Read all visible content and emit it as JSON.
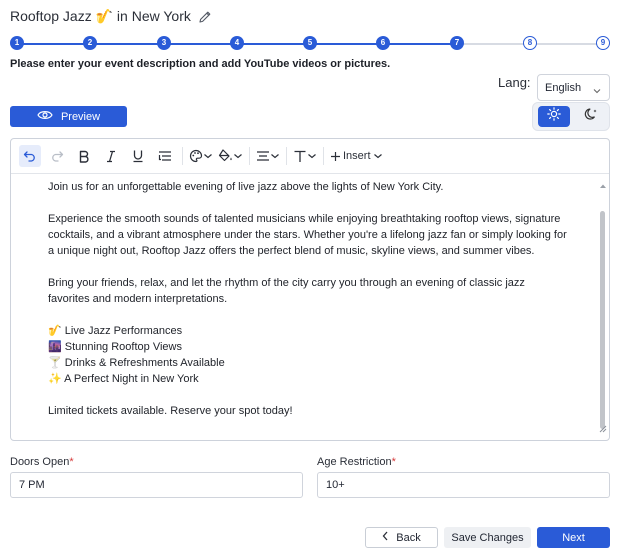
{
  "event": {
    "title": "Rooftop Jazz 🎷 in New York"
  },
  "stepper": {
    "steps": [
      {
        "label": "1",
        "done": true
      },
      {
        "label": "2",
        "done": true
      },
      {
        "label": "3",
        "done": true
      },
      {
        "label": "4",
        "done": true
      },
      {
        "label": "5",
        "done": true
      },
      {
        "label": "6",
        "done": true
      },
      {
        "label": "7",
        "done": true
      },
      {
        "label": "8",
        "done": false
      },
      {
        "label": "9",
        "done": false
      }
    ]
  },
  "instruction": "Please enter your event description and add YouTube videos or pictures.",
  "language": {
    "label": "Lang:",
    "selected": "English"
  },
  "preview_label": "Preview",
  "toolbar": {
    "insert_label": "Insert"
  },
  "description": {
    "paragraph1": "Join us for an unforgettable evening of live jazz above the lights of New York City.",
    "paragraph2_lines": [
      "Experience the smooth sounds of talented musicians while enjoying breathtaking rooftop views, signature",
      "cocktails, and a vibrant atmosphere under the stars. Whether you're a lifelong jazz fan or simply looking for",
      "a unique night out, Rooftop Jazz offers the perfect blend of music, skyline views, and summer vibes."
    ],
    "paragraph3_lines": [
      "Bring your friends, relax, and let the rhythm of the city carry you through an evening of classic jazz",
      "favorites and modern interpretations."
    ],
    "highlights": [
      "🎷 Live Jazz Performances",
      "🌆 Stunning Rooftop Views",
      "🍸 Drinks & Refreshments Available",
      "✨ A Perfect Night in New York"
    ],
    "closing": "Limited tickets available. Reserve your spot today!"
  },
  "fields": {
    "doors_open": {
      "label": "Doors Open",
      "value": "7 PM"
    },
    "age_restriction": {
      "label": "Age Restriction",
      "value": "10+"
    }
  },
  "required_marker": "*",
  "footer": {
    "back_label": "Back",
    "save_label": "Save Changes",
    "next_label": "Next"
  },
  "colors": {
    "accent": "#2a5bd7",
    "required": "#d63a3a"
  }
}
